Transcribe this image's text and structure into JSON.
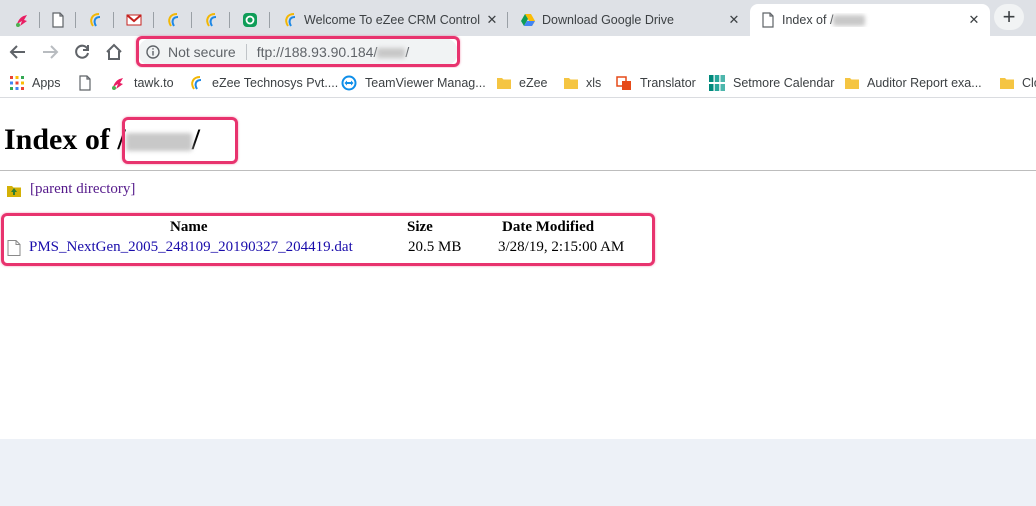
{
  "browser": {
    "tabs": [
      {
        "favicon": "tawk-icon",
        "title": ""
      },
      {
        "favicon": "page-icon",
        "title": ""
      },
      {
        "favicon": "ezee-icon",
        "title": ""
      },
      {
        "favicon": "gmail-icon",
        "title": ""
      },
      {
        "favicon": "ezee-icon",
        "title": ""
      },
      {
        "favicon": "ezee-icon",
        "title": ""
      },
      {
        "favicon": "green-icon",
        "title": ""
      },
      {
        "favicon": "ezee-icon",
        "title": "Welcome To eZee CRM Control P"
      },
      {
        "favicon": "drive-icon",
        "title": "Download Google Drive"
      },
      {
        "favicon": "page-icon",
        "title": "Index of /"
      }
    ],
    "close_glyph": "✕",
    "new_tab_glyph": "+",
    "address": {
      "security_label": "Not secure",
      "url_prefix": "ftp://188.93.90.184/",
      "url_suffix": "/"
    },
    "bookmarks": [
      {
        "icon": "apps-icon",
        "label": "Apps"
      },
      {
        "icon": "page-icon",
        "label": ""
      },
      {
        "icon": "tawk-icon",
        "label": "tawk.to"
      },
      {
        "icon": "ezee-icon",
        "label": "eZee Technosys Pvt...."
      },
      {
        "icon": "teamviewer-icon",
        "label": "TeamViewer Manag..."
      },
      {
        "icon": "folder-icon",
        "label": "eZee"
      },
      {
        "icon": "folder-icon",
        "label": "xls"
      },
      {
        "icon": "translator-icon",
        "label": "Translator"
      },
      {
        "icon": "setmore-icon",
        "label": "Setmore Calendar"
      },
      {
        "icon": "folder-icon",
        "label": "Auditor Report exa..."
      },
      {
        "icon": "folder-icon",
        "label": "Clo"
      }
    ]
  },
  "page": {
    "heading_prefix": "Index of /",
    "heading_suffix": "/",
    "parent_link": "[parent directory]",
    "columns": {
      "name": "Name",
      "size": "Size",
      "modified": "Date Modified"
    },
    "files": [
      {
        "name": "PMS_NextGen_2005_248109_20190327_204419.dat",
        "size": "20.5 MB",
        "modified": "3/28/19, 2:15:00 AM"
      }
    ]
  },
  "colors": {
    "highlight": "#e8336e",
    "link": "#1a0dab",
    "visited_link": "#551a8b"
  }
}
